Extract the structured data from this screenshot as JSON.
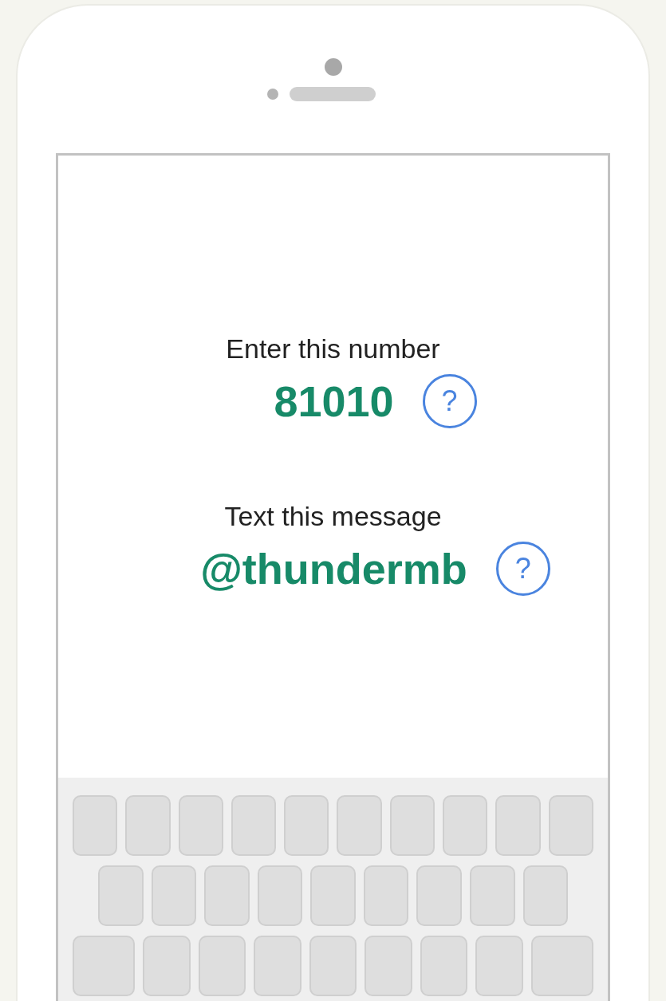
{
  "screen": {
    "groups": [
      {
        "label": "Enter this number",
        "value": "81010",
        "help": "?"
      },
      {
        "label": "Text this message",
        "value": "@thundermb",
        "help": "?"
      }
    ]
  }
}
